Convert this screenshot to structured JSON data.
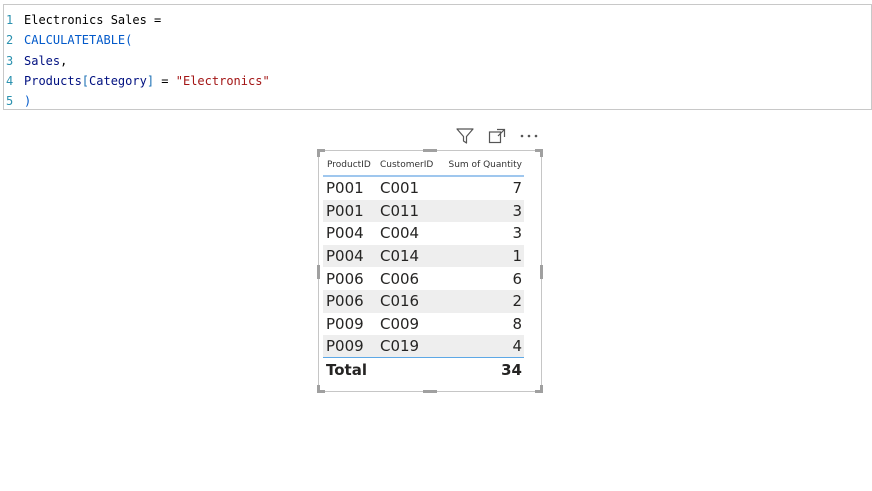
{
  "editor": {
    "lines": [
      {
        "number": "1",
        "tokens": [
          {
            "text": "Electronics Sales =",
            "kind": "plain"
          }
        ]
      },
      {
        "number": "2",
        "tokens": [
          {
            "text": "CALCULATETABLE(",
            "kind": "fn"
          }
        ]
      },
      {
        "number": "3",
        "tokens": [
          {
            "text": "Sales",
            "kind": "table"
          },
          {
            "text": ",",
            "kind": "plain"
          }
        ]
      },
      {
        "number": "4",
        "tokens": [
          {
            "text": "Products",
            "kind": "table"
          },
          {
            "text": "[",
            "kind": "bracket"
          },
          {
            "text": "Category",
            "kind": "col"
          },
          {
            "text": "]",
            "kind": "bracket"
          },
          {
            "text": " = ",
            "kind": "plain"
          },
          {
            "text": "\"Electronics\"",
            "kind": "str"
          }
        ]
      },
      {
        "number": "5",
        "tokens": [
          {
            "text": ")",
            "kind": "fn"
          }
        ]
      }
    ]
  },
  "visual_header": {
    "icons": [
      "filter-icon",
      "focus-mode-icon",
      "more-options-icon"
    ]
  },
  "table": {
    "columns": [
      "ProductID",
      "CustomerID",
      "Sum of Quantity"
    ],
    "rows": [
      [
        "P001",
        "C001",
        "7"
      ],
      [
        "P001",
        "C011",
        "3"
      ],
      [
        "P004",
        "C004",
        "3"
      ],
      [
        "P004",
        "C014",
        "1"
      ],
      [
        "P006",
        "C006",
        "6"
      ],
      [
        "P006",
        "C016",
        "2"
      ],
      [
        "P009",
        "C009",
        "8"
      ],
      [
        "P009",
        "C019",
        "4"
      ]
    ],
    "total": {
      "label": "Total",
      "value": "34"
    }
  },
  "colors": {
    "line_number": "#2b91af",
    "function": "#035aca",
    "string": "#a31515",
    "header_underline": "#9fc7ee",
    "row_alt": "#eeeeee"
  }
}
